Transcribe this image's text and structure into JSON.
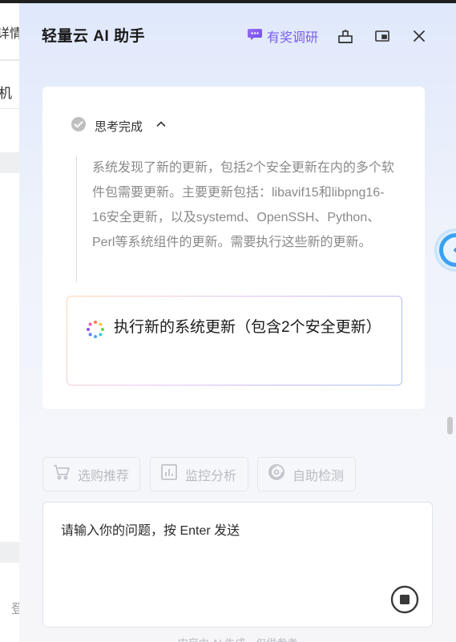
{
  "background_page": {
    "snippet_top": "详情",
    "snippet_mid": "机",
    "snippet_bottom": "登"
  },
  "header": {
    "title": "轻量云 AI 助手",
    "survey_label": "有奖调研",
    "icons": [
      "survey-chat-icon",
      "pin-icon",
      "window-toggle-icon",
      "close-icon"
    ]
  },
  "message": {
    "think_status": "思考完成",
    "think_text": "系统发现了新的更新，包括2个安全更新在内的多个软件包需要更新。主要更新包括：libavif15和libpng16-16安全更新，以及systemd、OpenSSH、Python、Perl等系统组件的更新。需要执行这些新的更新。",
    "task_text": "执行新的系统更新（包含2个安全更新）"
  },
  "quick_actions": [
    {
      "label": "选购推荐",
      "icon": "cart-icon"
    },
    {
      "label": "监控分析",
      "icon": "chart-icon"
    },
    {
      "label": "自助检测",
      "icon": "detect-icon"
    }
  ],
  "input": {
    "placeholder": "请输入你的问题，按 Enter 发送",
    "value": ""
  },
  "footer": {
    "note": "内容由 AI 生成，仅供参考"
  },
  "colors": {
    "accent_purple": "#7b5cf0",
    "side_tab_blue": "#3aa1f2"
  }
}
